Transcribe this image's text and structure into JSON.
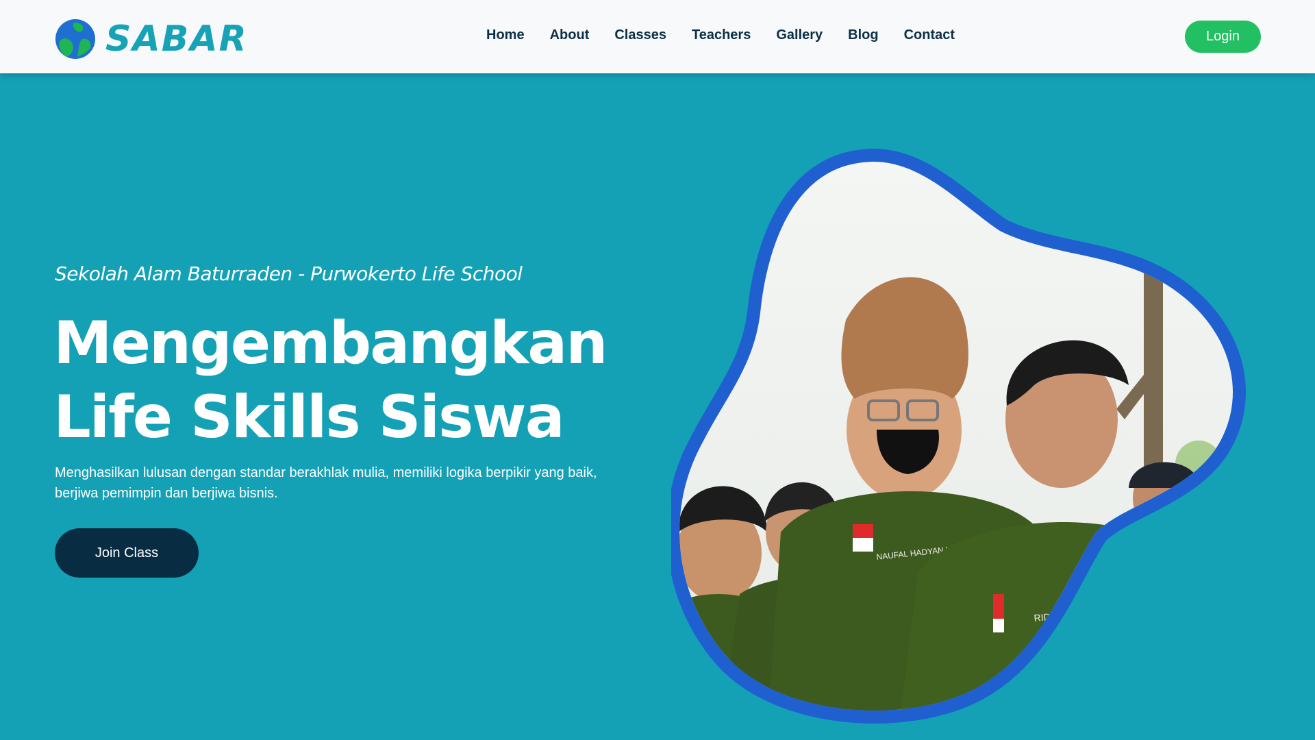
{
  "header": {
    "logo_text": "SABAR",
    "nav": [
      "Home",
      "About",
      "Classes",
      "Teachers",
      "Gallery",
      "Blog",
      "Contact"
    ],
    "login_label": "Login"
  },
  "hero": {
    "subtitle": "Sekolah Alam Baturraden - Purwokerto Life School",
    "headline": "Mengembangkan Life Skills Siswa",
    "description": "Menghasilkan lulusan dengan standar berakhlak mulia, memiliki logika berpikir yang baik, berjiwa pemimpin dan berjiwa bisnis.",
    "join_label": "Join Class",
    "photo": {
      "name_tag_left": "NAUFAL HADYAN H",
      "name_tag_right": "RIDWAN S"
    }
  },
  "colors": {
    "page_background": "#14a1b6",
    "header_background": "#f7f9fb",
    "logo": "#17a2b6",
    "nav_text": "#0b3045",
    "login_button": "#22c063",
    "join_button": "#082c42",
    "blob_border": "#1f5fd0",
    "uniform": "#3d5a1f"
  }
}
